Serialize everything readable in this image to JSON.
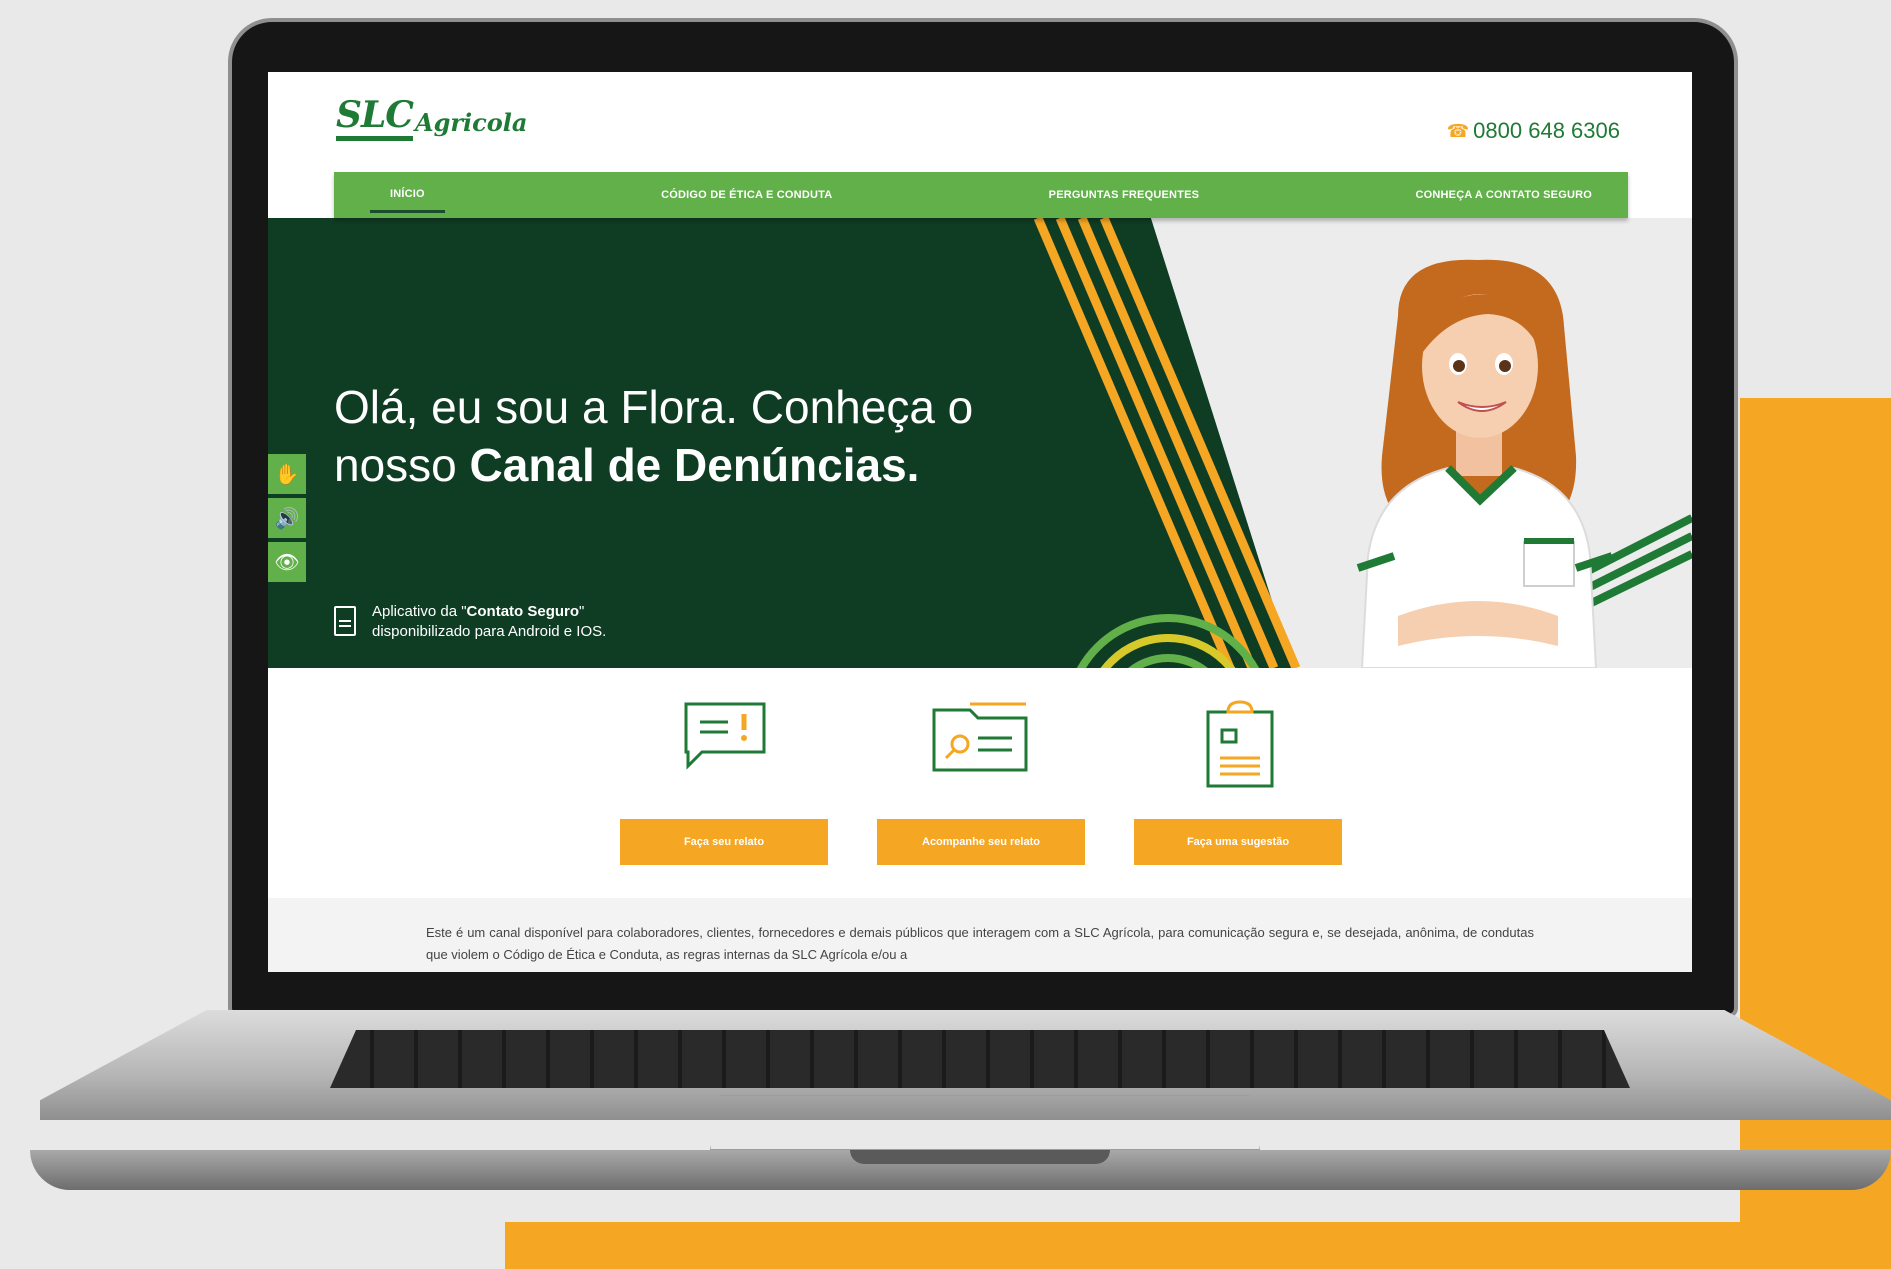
{
  "site": {
    "logo": {
      "brand": "SLC",
      "sub": "Agricola"
    },
    "phone": "0800 648 6306",
    "nav": [
      {
        "label": "INÍCIO",
        "active": true
      },
      {
        "label": "CÓDIGO DE ÉTICA E CONDUTA",
        "active": false
      },
      {
        "label": "PERGUNTAS FREQUENTES",
        "active": false
      },
      {
        "label": "CONHEÇA A CONTATO SEGURO",
        "active": false
      }
    ],
    "hero": {
      "title_line1": "Olá, eu sou a Flora. Conheça o",
      "title_line2_plain": "nosso ",
      "title_line2_bold": "Canal de Denúncias.",
      "app_prefix": "Aplicativo da \"",
      "app_brand": "Contato Seguro",
      "app_suffix": "\"",
      "app_line2": "disponibilizado para Android e IOS."
    },
    "accessibility": [
      {
        "icon": "sign-language-icon",
        "glyph": "✋"
      },
      {
        "icon": "audio-reader-icon",
        "glyph": "🔊"
      },
      {
        "icon": "eye-contrast-icon",
        "glyph": "👁"
      }
    ],
    "actions": [
      {
        "label": "Faça seu relato",
        "icon": "report-message-icon"
      },
      {
        "label": "Acompanhe seu relato",
        "icon": "folder-search-icon"
      },
      {
        "label": "Faça uma sugestão",
        "icon": "clipboard-icon"
      }
    ],
    "info_text": "Este é um canal disponível para colaboradores, clientes, fornecedores e demais públicos que interagem com a SLC Agrícola, para comunicação segura e, se desejada, anônima, de condutas que violem o Código de Ética e Conduta, as regras internas da SLC Agrícola e/ou a"
  },
  "colors": {
    "brand_green": "#1e7a34",
    "nav_green": "#62b04a",
    "hero_dark": "#0f3d24",
    "accent_orange": "#f5a623"
  }
}
